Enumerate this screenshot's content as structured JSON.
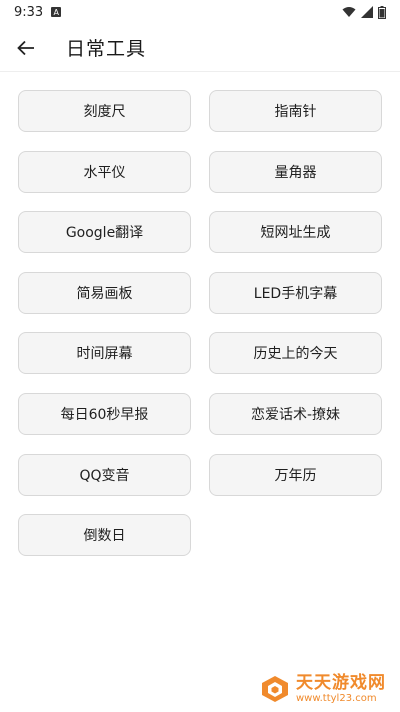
{
  "status_bar": {
    "time": "9:33",
    "notification_icon": "A"
  },
  "header": {
    "title": "日常工具"
  },
  "tools": [
    "刻度尺",
    "指南针",
    "水平仪",
    "量角器",
    "Google翻译",
    "短网址生成",
    "简易画板",
    "LED手机字幕",
    "时间屏幕",
    "历史上的今天",
    "每日60秒早报",
    "恋爱话术-撩妹",
    "QQ变音",
    "万年历",
    "倒数日"
  ],
  "watermark": {
    "name": "天天游戏网",
    "url": "www.ttyl23.com"
  }
}
